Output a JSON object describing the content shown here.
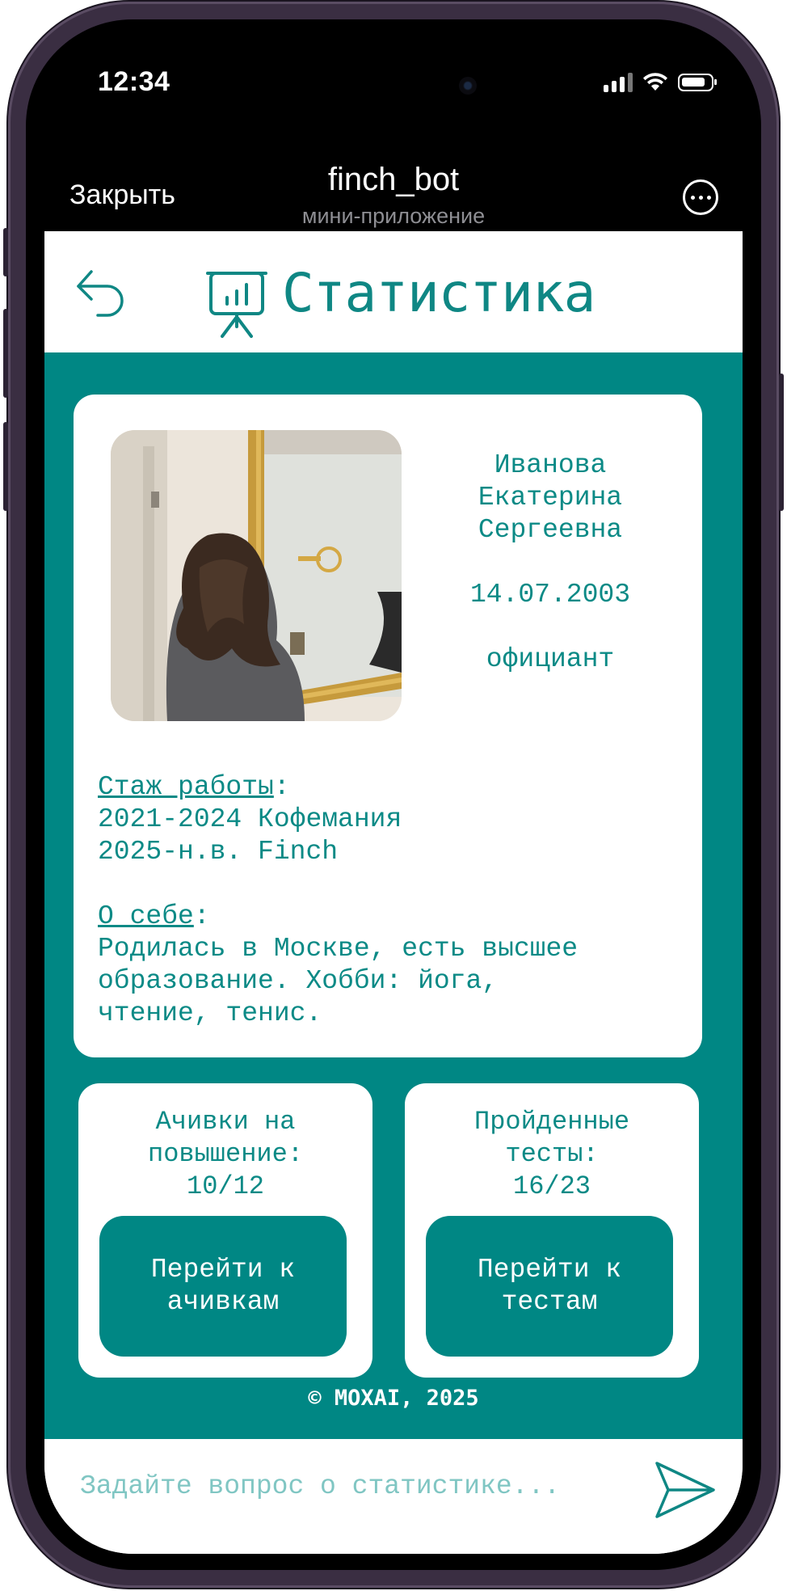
{
  "status_bar": {
    "time": "12:34"
  },
  "telegram": {
    "close_label": "Закрыть",
    "bot_name": "finch_bot",
    "bot_subtitle": "мини-приложение",
    "more_icon": "more-dots-icon"
  },
  "header": {
    "title": "Статистика",
    "back_icon": "back-arrow-icon",
    "title_icon": "presentation-board-chart-icon"
  },
  "profile": {
    "name_line1": "Иванова",
    "name_line2": "Екатерина",
    "name_line3": "Сергеевна",
    "birth_date": "14.07.2003",
    "position": "официант",
    "experience_label": "Стаж работы",
    "experience_colon": ":",
    "experience_1": "2021-2024 Кофемания",
    "experience_2": "2025-н.в. Finch",
    "about_label": "О себе",
    "about_colon": ":",
    "about_line1": "Родилась в Москве, есть высшее",
    "about_line2": "образование. Хобби: йога,",
    "about_line3": "чтение, тенис."
  },
  "achievements": {
    "title_line1": "Ачивки на",
    "title_line2": "повышение:",
    "count": "10/12",
    "button_line1": "Перейти к",
    "button_line2": "ачивкам"
  },
  "tests": {
    "title_line1": "Пройденные",
    "title_line2": "тесты:",
    "count": "16/23",
    "button_line1": "Перейти к",
    "button_line2": "тестам"
  },
  "footer": {
    "copyright": "© MOXAI, 2025"
  },
  "chat": {
    "placeholder": "Задайте вопрос о статистике...",
    "send_icon": "send-icon"
  },
  "colors": {
    "accent": "#008784",
    "text_teal": "#0b8a86",
    "placeholder": "#80c6c3"
  }
}
